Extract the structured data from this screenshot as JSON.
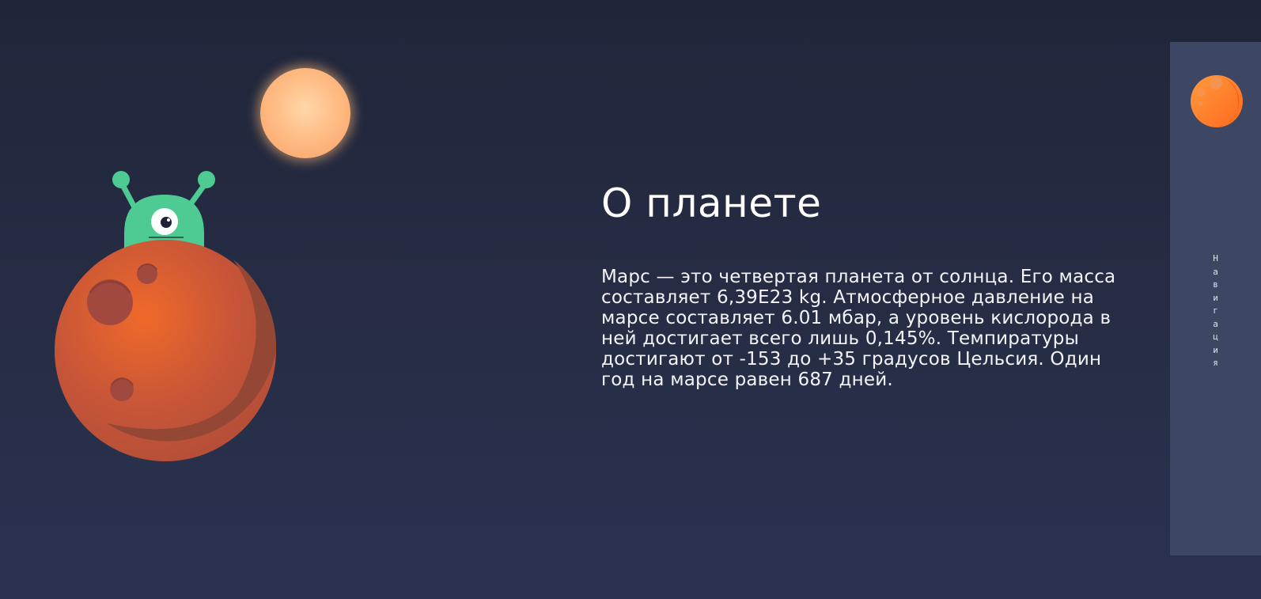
{
  "about": {
    "title": "О планете",
    "text": "Марс — это четвертая планета от солнца. Его масса составляет 6,39E23 kg. Атмосферное давление на марсе составляет 6.01 мбар, а уровень кислорода в ней достигает всего лишь 0,145%. Темпиратуры достигают от -153 до +35 градусов Цельсия. Один год на марсе равен 687 дней."
  },
  "nav": {
    "label": "Навигация"
  },
  "icons": {
    "sun": "sun-icon",
    "alien": "alien-icon",
    "mars": "mars-planet-icon",
    "nav_planet": "planet-icon"
  },
  "colors": {
    "background": "#232a3f",
    "sidebar": "#3d4662",
    "mars": "#c2502c",
    "alien": "#4ecb93",
    "sun": "#ffc08e"
  }
}
